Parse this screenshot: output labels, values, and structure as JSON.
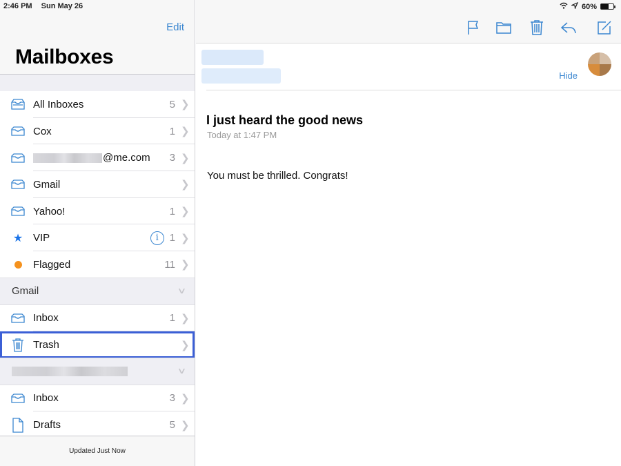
{
  "status_bar": {
    "time": "2:46 PM",
    "date": "Sun May 26",
    "battery_percent_label": "60%",
    "battery_level": 0.6
  },
  "sidebar": {
    "edit_label": "Edit",
    "title": "Mailboxes",
    "items": [
      {
        "label": "All Inboxes",
        "count": "5",
        "icon": "inbox-tray-icon"
      },
      {
        "label": "Cox",
        "count": "1",
        "icon": "inbox-tray-icon"
      },
      {
        "label": "@me.com",
        "count": "3",
        "icon": "inbox-tray-icon"
      },
      {
        "label": "Gmail",
        "count": "",
        "icon": "inbox-tray-icon"
      },
      {
        "label": "Yahoo!",
        "count": "1",
        "icon": "inbox-tray-icon"
      },
      {
        "label": "VIP",
        "count": "1",
        "icon": "star-icon"
      },
      {
        "label": "Flagged",
        "count": "11",
        "icon": "orange-dot-icon"
      }
    ],
    "gmail_section": {
      "title": "Gmail",
      "items": [
        {
          "label": "Inbox",
          "count": "1",
          "icon": "inbox-tray-icon"
        },
        {
          "label": "Trash",
          "count": "",
          "icon": "trash-icon",
          "selected": true
        }
      ]
    },
    "other_section": {
      "title": "",
      "items": [
        {
          "label": "Inbox",
          "count": "3",
          "icon": "inbox-tray-icon"
        },
        {
          "label": "Drafts",
          "count": "5",
          "icon": "document-icon"
        }
      ]
    },
    "footer": "Updated Just Now"
  },
  "toolbar": {
    "icons": [
      "flag-icon",
      "folder-icon",
      "trash-icon",
      "reply-icon",
      "compose-icon"
    ]
  },
  "message": {
    "hide_label": "Hide",
    "subject": "I just heard the good news",
    "date": "Today at 1:47 PM",
    "body": "You must be thrilled. Congrats!"
  },
  "colors": {
    "accent": "#3a86d0",
    "selection_outline": "#3b5fd6",
    "flag_orange": "#f5921e",
    "vip_blue": "#1a73e8"
  }
}
